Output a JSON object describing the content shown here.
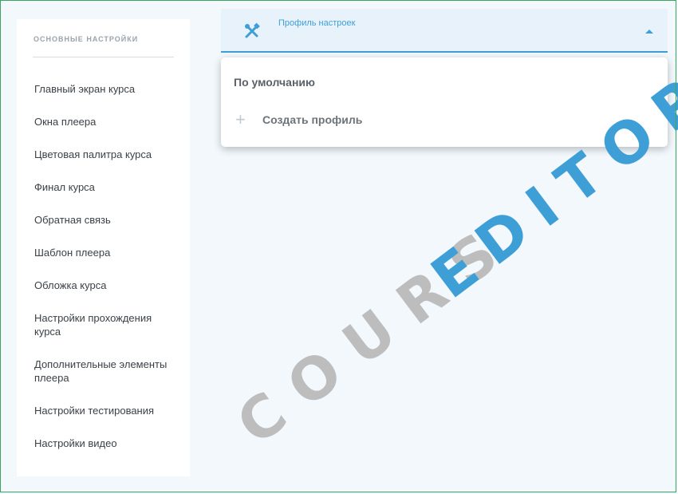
{
  "sidebar": {
    "title": "ОСНОВНЫЕ НАСТРОЙКИ",
    "items": [
      {
        "label": "Главный экран курса"
      },
      {
        "label": "Окна плеера"
      },
      {
        "label": "Цветовая палитра курса"
      },
      {
        "label": "Финал курса"
      },
      {
        "label": "Обратная связь"
      },
      {
        "label": "Шаблон плеера"
      },
      {
        "label": "Обложка курса"
      },
      {
        "label": "Настройки прохождения курса"
      },
      {
        "label": "Дополнительные элементы плеера"
      },
      {
        "label": "Настройки тестирования"
      },
      {
        "label": "Настройки видео"
      }
    ]
  },
  "profile": {
    "label": "Профиль настроек",
    "icon": "tools-icon",
    "options": {
      "default": "По умолчанию",
      "create": "Создать профиль"
    }
  },
  "watermark": {
    "part1": "COURS",
    "part2": "EDITOR"
  },
  "colors": {
    "accent": "#3e9fd7",
    "watermark_gray": "#bdbdbd",
    "frame": "#3aa55e"
  }
}
